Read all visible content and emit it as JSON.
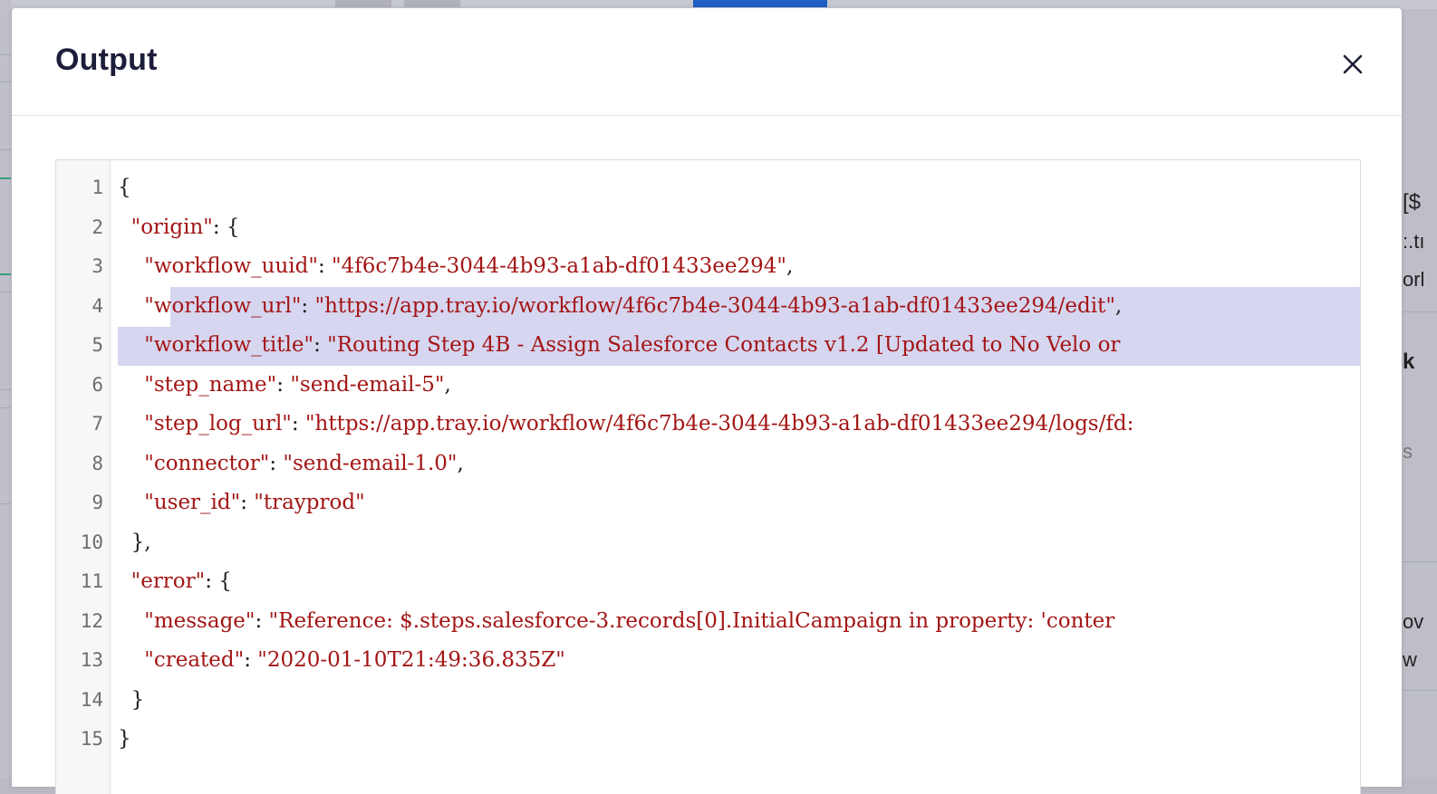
{
  "modal": {
    "title": "Output",
    "close_label": "×"
  },
  "editor": {
    "lines": [
      {
        "n": "1",
        "indent": "",
        "key": "",
        "sep": "{",
        "val": "",
        "tail": ""
      },
      {
        "n": "2",
        "indent": "  ",
        "key": "\"origin\"",
        "sep": ": {",
        "val": "",
        "tail": ""
      },
      {
        "n": "3",
        "indent": "    ",
        "key": "\"workflow_uuid\"",
        "sep": ": ",
        "val": "\"4f6c7b4e-3044-4b93-a1ab-df01433ee294\"",
        "tail": ","
      },
      {
        "n": "4",
        "indent": "    ",
        "key": "\"workflow_url\"",
        "sep": ": ",
        "val": "\"https://app.tray.io/workflow/4f6c7b4e-3044-4b93-a1ab-df01433ee294/edit\"",
        "tail": ","
      },
      {
        "n": "5",
        "indent": "    ",
        "key": "\"workflow_title\"",
        "sep": ": ",
        "val": "\"Routing Step 4B - Assign Salesforce Contacts v1.2 [Updated to No Velo or",
        "tail": ""
      },
      {
        "n": "6",
        "indent": "    ",
        "key": "\"step_name\"",
        "sep": ": ",
        "val": "\"send-email-5\"",
        "tail": ","
      },
      {
        "n": "7",
        "indent": "    ",
        "key": "\"step_log_url\"",
        "sep": ": ",
        "val": "\"https://app.tray.io/workflow/4f6c7b4e-3044-4b93-a1ab-df01433ee294/logs/fd:",
        "tail": ""
      },
      {
        "n": "8",
        "indent": "    ",
        "key": "\"connector\"",
        "sep": ": ",
        "val": "\"send-email-1.0\"",
        "tail": ","
      },
      {
        "n": "9",
        "indent": "    ",
        "key": "\"user_id\"",
        "sep": ": ",
        "val": "\"trayprod\"",
        "tail": ""
      },
      {
        "n": "10",
        "indent": "  ",
        "key": "",
        "sep": "},",
        "val": "",
        "tail": ""
      },
      {
        "n": "11",
        "indent": "  ",
        "key": "\"error\"",
        "sep": ": {",
        "val": "",
        "tail": ""
      },
      {
        "n": "12",
        "indent": "    ",
        "key": "\"message\"",
        "sep": ": ",
        "val": "\"Reference: $.steps.salesforce-3.records[0].InitialCampaign in property: 'conter",
        "tail": ""
      },
      {
        "n": "13",
        "indent": "    ",
        "key": "\"created\"",
        "sep": ": ",
        "val": "\"2020-01-10T21:49:36.835Z\"",
        "tail": ""
      },
      {
        "n": "14",
        "indent": "  ",
        "key": "",
        "sep": "}",
        "val": "",
        "tail": ""
      },
      {
        "n": "15",
        "indent": "",
        "key": "",
        "sep": "}",
        "val": "",
        "tail": ""
      }
    ]
  },
  "background_fragments": [
    "[$",
    ":.tı",
    "orl",
    "k",
    "s",
    "ov",
    "w"
  ],
  "colors": {
    "string": "#a31515",
    "punctuation": "#202020",
    "selection": "#d6d6f0",
    "accent": "#1f5fc4"
  }
}
